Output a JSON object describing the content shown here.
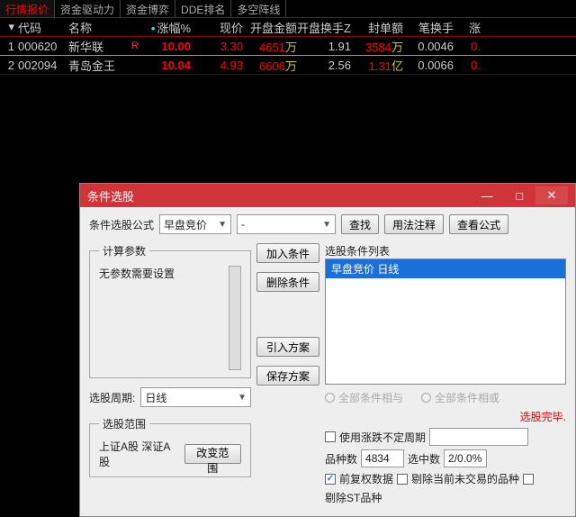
{
  "tabs": [
    "行情报价",
    "资金驱动力",
    "资金博弈",
    "DDE排名",
    "多空阵线"
  ],
  "active_tab": 0,
  "columns": {
    "idx": "",
    "code": "代码",
    "name": "名称",
    "pct": "涨幅%",
    "price": "现价",
    "kpe": "开盘金额",
    "kph": "开盘换手Z",
    "fde": "封单额",
    "bh": "笔换手",
    "z": "涨"
  },
  "rows": [
    {
      "idx": "1",
      "code": "000620",
      "name": "新华联",
      "r": "R",
      "pct": "10.00",
      "price": "3.30",
      "kpe_n": "4651",
      "kpe_u": "万",
      "kph": "1.91",
      "fde_n": "3584",
      "fde_u": "万",
      "bh": "0.0046",
      "z": "0."
    },
    {
      "idx": "2",
      "code": "002094",
      "name": "青岛金王",
      "r": "",
      "pct": "10.04",
      "price": "4.93",
      "kpe_n": "6606",
      "kpe_u": "万",
      "kph": "2.56",
      "fde_n": "1.31",
      "fde_u": "亿",
      "bh": "0.0066",
      "z": "0."
    }
  ],
  "dialog": {
    "title": "条件选股",
    "formula_label": "条件选股公式",
    "formula_combo": "早盘竞价",
    "formula_dash": "-",
    "find": "查找",
    "usage": "用法注释",
    "view": "查看公式",
    "calc_legend": "计算参数",
    "calc_msg": "无参数需要设置",
    "period_label": "选股周期:",
    "period_combo": "日线",
    "scope_legend": "选股范围",
    "scope_text": "上证A股 深证A股",
    "scope_btn": "改变范围",
    "mid": {
      "add": "加入条件",
      "del": "删除条件",
      "import": "引入方案",
      "save": "保存方案"
    },
    "list_legend": "选股条件列表",
    "list_item": "早盘竞价  日线",
    "radio_and": "全部条件相与",
    "radio_or": "全部条件相或",
    "status": "选股完毕.",
    "chk_period": "使用涨跌不定周期",
    "count_lbl": "品种数",
    "count_val": "4834",
    "sel_lbl": "选中数",
    "sel_val": "2/0.0%",
    "chk_fq": "前复权数据",
    "chk_excl1": "剔除当前未交易的品种",
    "chk_excl2": "剔除ST品种"
  }
}
